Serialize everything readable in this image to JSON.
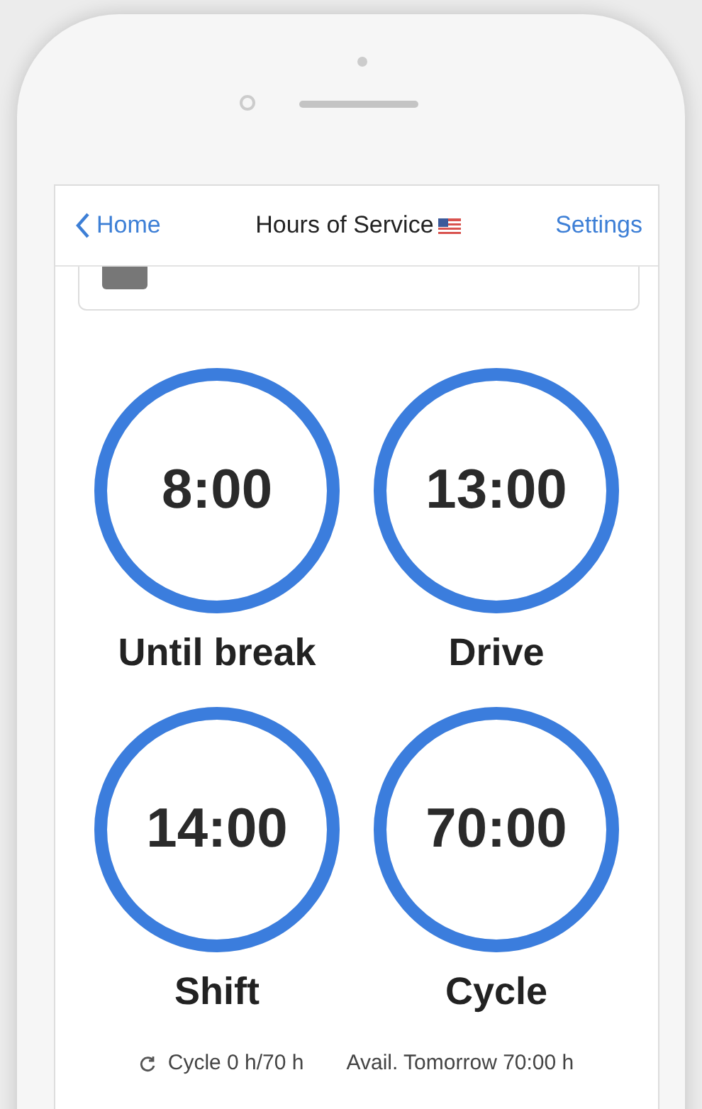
{
  "nav": {
    "back": "Home",
    "title": "Hours of Service",
    "action": "Settings"
  },
  "timers": [
    {
      "value": "8:00",
      "label": "Until break",
      "level": 1
    },
    {
      "value": "13:00",
      "label": "Drive",
      "level": 1
    },
    {
      "value": "14:00",
      "label": "Shift",
      "level": 1
    },
    {
      "value": "70:00",
      "label": "Cycle",
      "level": 1
    }
  ],
  "footer": {
    "cycle": "Cycle 0 h/70 h",
    "available": "Avail. Tomorrow 70:00 h"
  }
}
